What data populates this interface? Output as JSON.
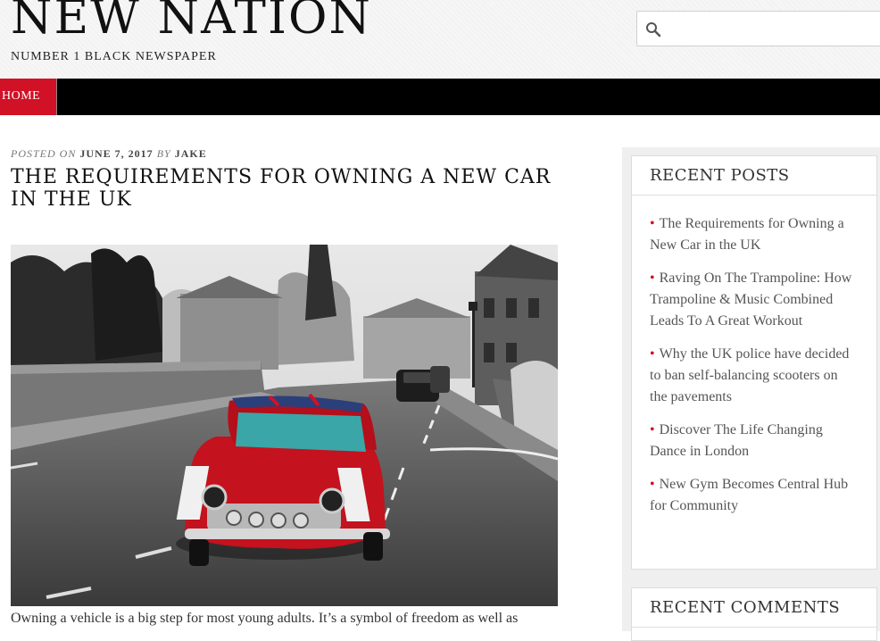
{
  "site": {
    "title": "NEW NATION",
    "tagline": "NUMBER 1 BLACK NEWSPAPER"
  },
  "search": {
    "placeholder": "",
    "value": ""
  },
  "nav": {
    "home_label": "HOME"
  },
  "post": {
    "posted_on": "POSTED ON",
    "date": "JUNE 7, 2017",
    "by": "BY",
    "author": "JAKE",
    "title": "THE REQUIREMENTS FOR OWNING A NEW CAR IN THE UK",
    "excerpt": "Owning a vehicle is a big step for most young adults. It’s a symbol of freedom as well as"
  },
  "sidebar": {
    "recent_posts_title": "RECENT POSTS",
    "recent_posts": [
      "The Requirements for Owning a New Car in the UK",
      "Raving On The Trampoline: How Trampoline & Music Combined Leads To A Great Workout",
      "Why the UK police have decided to ban self-balancing scooters on the pavements",
      "Discover The Life Changing Dance in London",
      "New Gym Becomes Central Hub for Community"
    ],
    "recent_comments_title": "RECENT COMMENTS"
  },
  "colors": {
    "accent": "#d11125",
    "nav_bg": "#000000",
    "sidebar_bg": "#efefef"
  }
}
